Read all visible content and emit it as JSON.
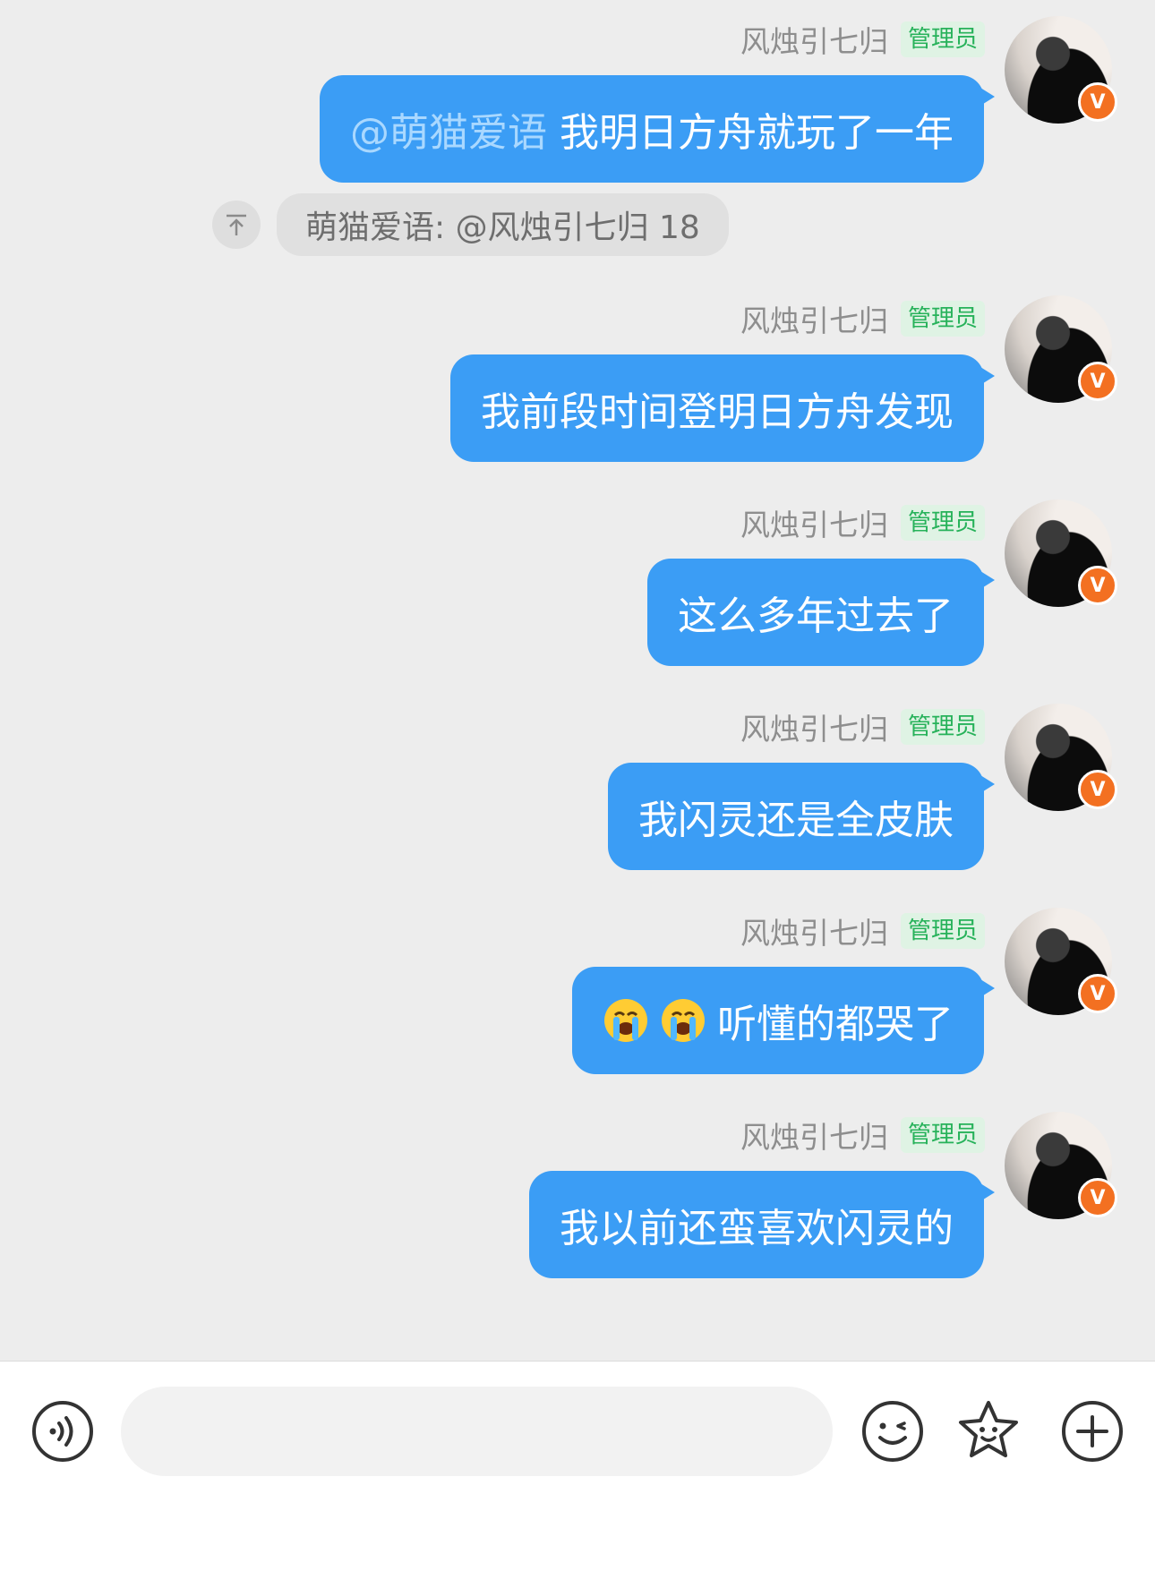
{
  "colors": {
    "bubble": "#3b9df5",
    "role_badge_text": "#27b25a",
    "verified_badge": "#f37021"
  },
  "sender": {
    "name": "风烛引七归",
    "role": "管理员",
    "verified_badge": "V"
  },
  "messages": [
    {
      "mention": "@萌猫爱语",
      "text": "我明日方舟就玩了一年"
    },
    {
      "text": "我前段时间登明日方舟发现"
    },
    {
      "text": "这么多年过去了"
    },
    {
      "text": "我闪灵还是全皮肤"
    },
    {
      "emojis": [
        "loudly-crying-face-icon",
        "loudly-crying-face-icon"
      ],
      "text": "听懂的都哭了"
    },
    {
      "text": "我以前还蛮喜欢闪灵的"
    }
  ],
  "quoted_reply": {
    "text": "萌猫爱语: @风烛引七归 18",
    "icon": "arrow-up-to-top-icon"
  },
  "input_bar": {
    "value": "",
    "icons": [
      "voice-icon",
      "emoji-icon",
      "sticker-star-icon",
      "plus-icon"
    ]
  }
}
